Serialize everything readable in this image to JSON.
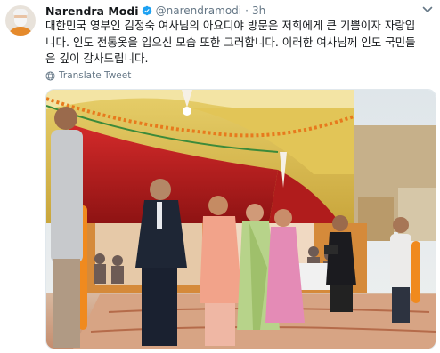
{
  "author": {
    "name": "Narendra Modi",
    "handle": "@narendramodi",
    "separator": "·",
    "time": "3h"
  },
  "tweet": {
    "lines": [
      "대한민국 영부인 김정숙 여사님의 아요디야 방문은 저희에게 큰 기쁨이자 자랑입",
      "니다. 인도 전통옷을 입으신 모습 또한 그러합니다. 이러한 여사님께 인도 국민들",
      "은 깊이 감사드립니다."
    ],
    "translate_label": "Translate Tweet"
  },
  "colors": {
    "verified": "#1da1f2",
    "secondary_text": "#657786",
    "primary_text": "#14171a"
  },
  "icons": {
    "verified": "verified-badge-icon",
    "caret": "chevron-down-icon",
    "translate": "globe-icon"
  }
}
